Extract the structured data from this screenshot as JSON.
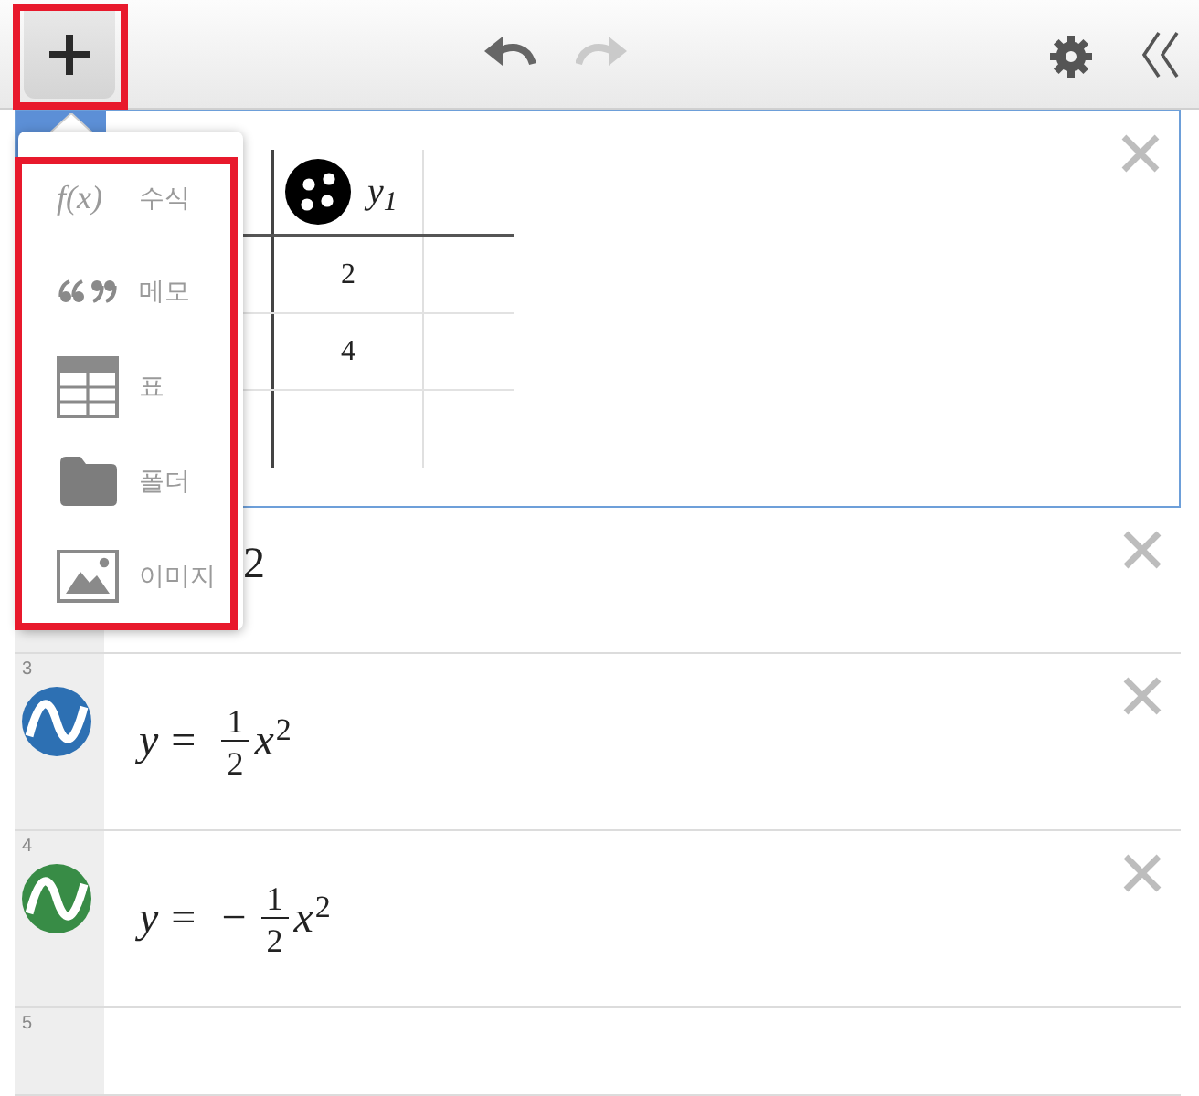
{
  "toolbar": {
    "add_button": {
      "highlighted": true
    },
    "undo": {
      "disabled": false
    },
    "redo": {
      "disabled": true
    }
  },
  "add_menu": {
    "highlighted": true,
    "items": [
      {
        "kind": "expression",
        "symbol": "f(x)",
        "label": "수식"
      },
      {
        "kind": "note",
        "label": "메모"
      },
      {
        "kind": "table",
        "label": "표"
      },
      {
        "kind": "folder",
        "label": "폴더"
      },
      {
        "kind": "image",
        "label": "이미지"
      }
    ]
  },
  "expressions": [
    {
      "kind": "table",
      "selected": true,
      "columns": [
        {
          "header": "y$_{1}$",
          "cells": [
            "2",
            "4"
          ]
        }
      ]
    },
    {
      "kind": "covered",
      "selected": false,
      "text": "2"
    },
    {
      "kind": "expression",
      "selected": false,
      "number": "3",
      "color": "#2d70b3",
      "formula": {
        "lhs": "y",
        "relation": "=",
        "numerator": "1",
        "denominator": "2",
        "variable": "x",
        "exponent": "2"
      }
    },
    {
      "kind": "expression",
      "selected": false,
      "number": "4",
      "color": "#388c46",
      "formula": {
        "lhs": "y",
        "relation": "=",
        "sign": "−",
        "numerator": "1",
        "denominator": "2",
        "variable": "x",
        "exponent": "2"
      }
    },
    {
      "kind": "empty",
      "selected": false,
      "number": "5"
    }
  ]
}
